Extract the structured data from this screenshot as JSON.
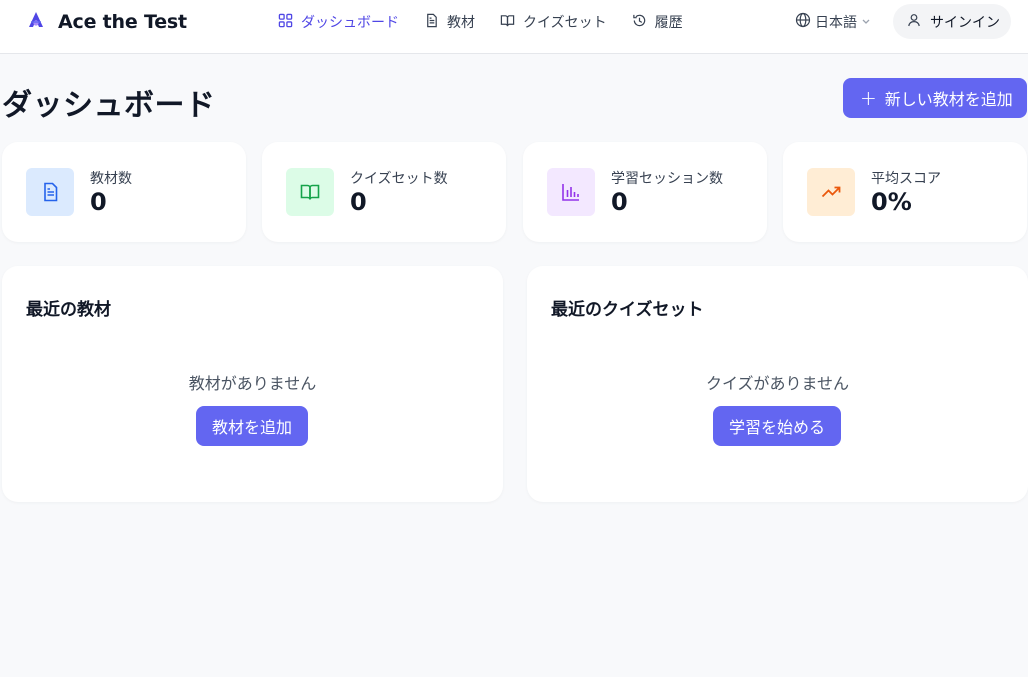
{
  "app": {
    "name": "Ace the Test"
  },
  "nav": [
    {
      "label": "ダッシュボード",
      "icon": "dashboard-grid-icon",
      "active": true
    },
    {
      "label": "教材",
      "icon": "document-icon",
      "active": false
    },
    {
      "label": "クイズセット",
      "icon": "open-book-icon",
      "active": false
    },
    {
      "label": "履歴",
      "icon": "history-icon",
      "active": false
    }
  ],
  "header": {
    "language": "日本語",
    "signin_label": "サインイン"
  },
  "page": {
    "title": "ダッシュボード",
    "add_button_label": "新しい教材を追加"
  },
  "stats": [
    {
      "label": "教材数",
      "value": "0",
      "icon": "document-icon",
      "color": "#2563eb",
      "bg": "#dbeafe"
    },
    {
      "label": "クイズセット数",
      "value": "0",
      "icon": "open-book-icon",
      "color": "#16a34a",
      "bg": "#dcfce7"
    },
    {
      "label": "学習セッション数",
      "value": "0",
      "icon": "bar-chart-icon",
      "color": "#9333ea",
      "bg": "#f3e8ff"
    },
    {
      "label": "平均スコア",
      "value": "0%",
      "icon": "trending-up-icon",
      "color": "#ea580c",
      "bg": "#ffedd5"
    }
  ],
  "panels": {
    "recent_materials": {
      "title": "最近の教材",
      "empty_text": "教材がありません",
      "button_label": "教材を追加"
    },
    "recent_quizsets": {
      "title": "最近のクイズセット",
      "empty_text": "クイズがありません",
      "button_label": "学習を始める"
    }
  },
  "colors": {
    "accent": "#6366f1",
    "nav_active": "#4f46e5"
  }
}
